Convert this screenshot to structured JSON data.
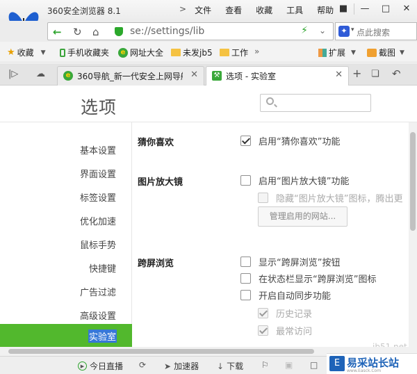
{
  "window": {
    "title": "360安全浏览器 8.1",
    "menu": [
      "文件",
      "查看",
      "收藏",
      "工具",
      "帮助"
    ]
  },
  "address": {
    "url": "se://settings/lib",
    "search_placeholder": "点此搜索"
  },
  "bookmarks": {
    "favorites_label": "收藏",
    "items": [
      "手机收藏夹",
      "网址大全",
      "未发jb5",
      "工作"
    ],
    "extensions_label": "扩展",
    "screenshot_label": "截图"
  },
  "tabs": [
    {
      "label": "360导航_新一代安全上网导航",
      "active": false
    },
    {
      "label": "选项 - 实验室",
      "active": true
    }
  ],
  "page": {
    "title": "选项",
    "search_value": "",
    "sidebar": [
      "基本设置",
      "界面设置",
      "标签设置",
      "优化加速",
      "鼠标手势",
      "快捷键",
      "广告过滤",
      "高级设置",
      "实验室"
    ],
    "active_sidebar": "实验室",
    "sections": {
      "guess": {
        "title": "猜你喜欢",
        "options": [
          {
            "label": "启用“猜你喜欢”功能",
            "checked": true,
            "enabled": true
          }
        ]
      },
      "magnifier": {
        "title": "图片放大镜",
        "options": [
          {
            "label": "启用“图片放大镜”功能",
            "checked": false,
            "enabled": true
          },
          {
            "label": "隐藏“图片放大镜”图标，腾出更",
            "checked": false,
            "enabled": false
          }
        ],
        "manage_button": "管理启用的网站..."
      },
      "crossscreen": {
        "title": "跨屏浏览",
        "options": [
          {
            "label": "显示“跨屏浏览”按钮",
            "checked": false,
            "enabled": true
          },
          {
            "label": "在状态栏显示“跨屏浏览”图标",
            "checked": false,
            "enabled": true
          },
          {
            "label": "开启自动同步功能",
            "checked": false,
            "enabled": true
          },
          {
            "label": "历史记录",
            "checked": true,
            "enabled": false
          },
          {
            "label": "最常访问",
            "checked": true,
            "enabled": false
          }
        ]
      }
    }
  },
  "statusbar": {
    "items": [
      "今日直播",
      "加速器",
      "下载"
    ]
  },
  "watermark": {
    "text": "易采站长站",
    "url": "www.Easck.Com",
    "faded": "jb51.net"
  },
  "colors": {
    "accent_green": "#52b82d",
    "selection_blue": "#3778d8",
    "watermark_blue": "#1e63b8"
  }
}
